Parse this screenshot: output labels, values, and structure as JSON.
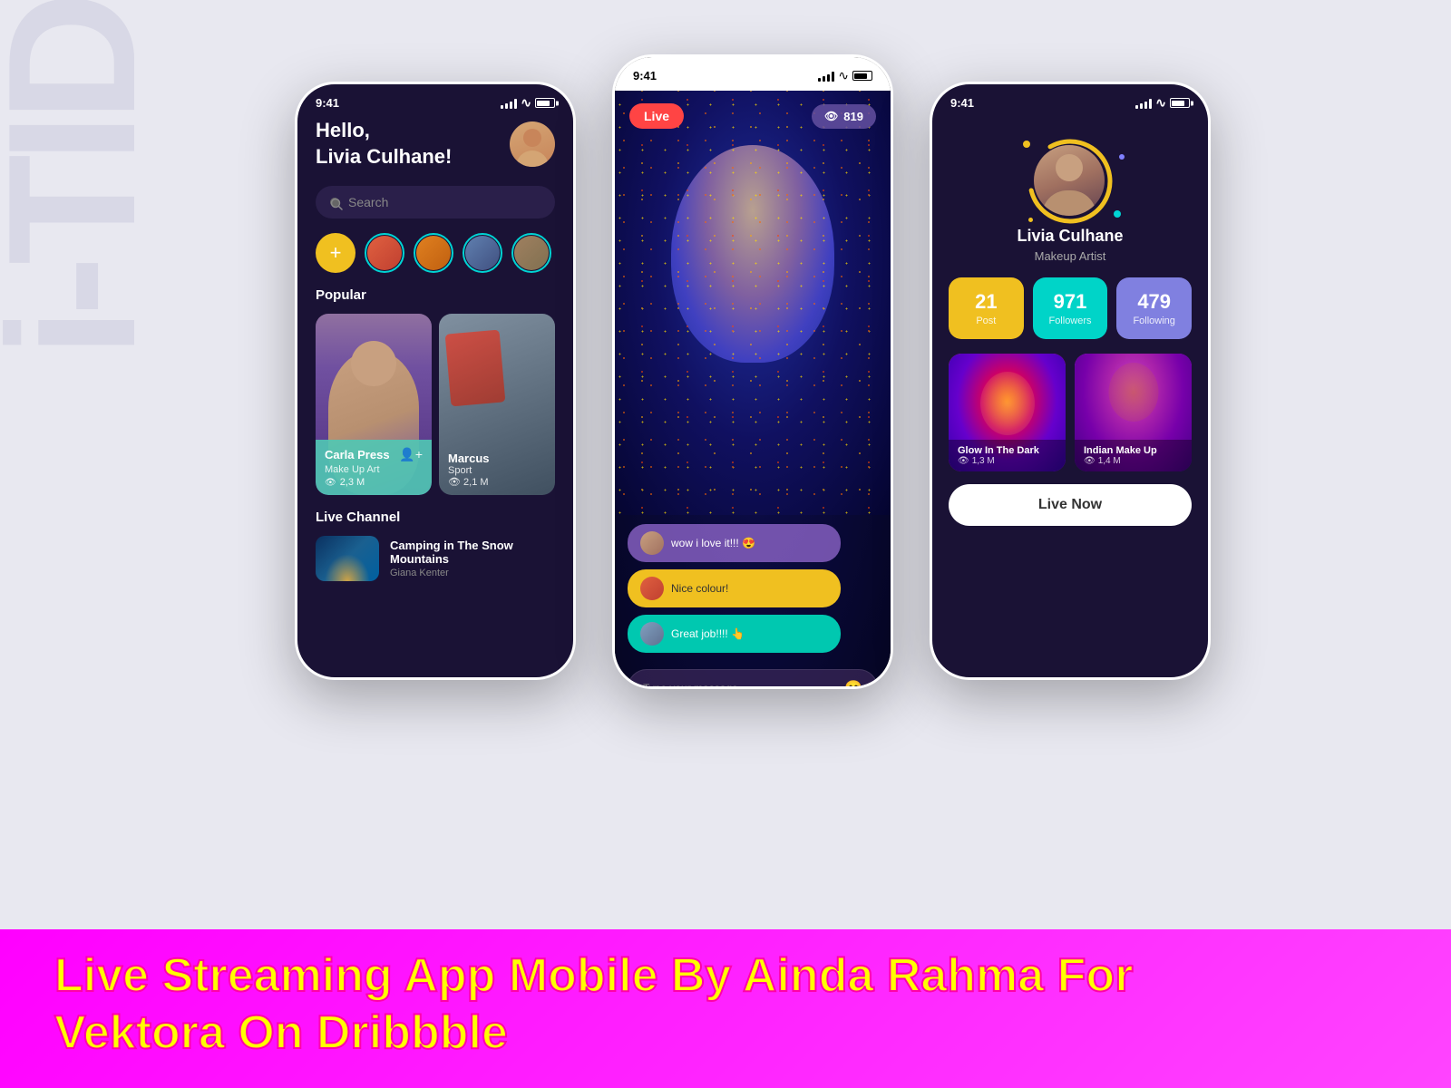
{
  "watermark": "i-TID",
  "phones": {
    "phone1": {
      "statusBar": {
        "time": "9:41"
      },
      "greeting": "Hello,\nLivia Culhane!",
      "search": {
        "placeholder": "Search"
      },
      "addStoryLabel": "+",
      "popularLabel": "Popular",
      "cards": [
        {
          "name": "Carla Press",
          "category": "Make Up Art",
          "views": "2,3 M"
        },
        {
          "name": "Marcus",
          "category": "Sport",
          "views": "2,1 M"
        }
      ],
      "liveChannelLabel": "Live Channel",
      "liveChannel": {
        "title": "Camping in The Snow Mountains",
        "author": "Giana Kenter"
      }
    },
    "phone2": {
      "statusBar": {
        "time": "9:41"
      },
      "liveBadge": "Live",
      "viewerCount": "819",
      "chat": [
        {
          "text": "wow i love it!!! 😍",
          "style": "purple"
        },
        {
          "text": "Nice colour!",
          "style": "yellow"
        },
        {
          "text": "Great job!!!! 👆",
          "style": "teal"
        }
      ],
      "messagePlaceholder": "Type your massage ..."
    },
    "phone3": {
      "statusBar": {
        "time": "9:41"
      },
      "profileName": "Livia Culhane",
      "profileSubtitle": "Makeup Artist",
      "stats": [
        {
          "value": "21",
          "label": "Post",
          "style": "yellow"
        },
        {
          "value": "971",
          "label": "Followers",
          "style": "teal"
        },
        {
          "value": "479",
          "label": "Following",
          "style": "purple"
        }
      ],
      "contentCards": [
        {
          "title": "Glow In The Dark",
          "views": "1,3 M"
        },
        {
          "title": "Indian Make Up",
          "views": "1,4 M"
        }
      ],
      "liveNowButton": "Live Now"
    }
  },
  "bottomTitle": {
    "line1": "Live Streaming App Mobile By Ainda Rahma For",
    "line2": "Vektora On Dribbble"
  }
}
